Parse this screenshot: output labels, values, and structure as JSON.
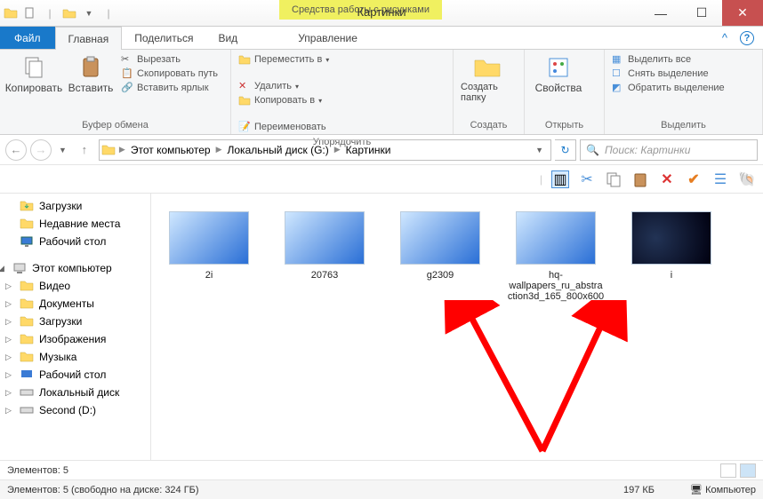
{
  "titlebar": {
    "context_label": "Средства работы с рисунками",
    "title": "Картинки"
  },
  "tabs": {
    "file": "Файл",
    "home": "Главная",
    "share": "Поделиться",
    "view": "Вид",
    "manage": "Управление"
  },
  "ribbon": {
    "clipboard": {
      "copy": "Копировать",
      "paste": "Вставить",
      "cut": "Вырезать",
      "copy_path": "Скопировать путь",
      "paste_shortcut": "Вставить ярлык",
      "label": "Буфер обмена"
    },
    "organize": {
      "move_to": "Переместить в",
      "copy_to": "Копировать в",
      "delete": "Удалить",
      "rename": "Переименовать",
      "label": "Упорядочить"
    },
    "new": {
      "new_folder": "Создать папку",
      "label": "Создать"
    },
    "open": {
      "properties": "Свойства",
      "label": "Открыть"
    },
    "select": {
      "select_all": "Выделить все",
      "select_none": "Снять выделение",
      "invert": "Обратить выделение",
      "label": "Выделить"
    }
  },
  "breadcrumb": {
    "this_pc": "Этот компьютер",
    "drive": "Локальный диск (G:)",
    "folder": "Картинки"
  },
  "search": {
    "placeholder": "Поиск: Картинки"
  },
  "nav": {
    "downloads": "Загрузки",
    "recent": "Недавние места",
    "desktop": "Рабочий стол",
    "this_pc": "Этот компьютер",
    "videos": "Видео",
    "documents": "Документы",
    "downloads2": "Загрузки",
    "pictures": "Изображения",
    "music": "Музыка",
    "desktop2": "Рабочий стол",
    "local_disk": "Локальный диск",
    "second": "Second (D:)"
  },
  "files": [
    {
      "name": "2i"
    },
    {
      "name": "20763"
    },
    {
      "name": "g2309"
    },
    {
      "name": "hq-wallpapers_ru_abstraction3d_165_800x600"
    },
    {
      "name": "i"
    }
  ],
  "info": {
    "elements": "Элементов: 5"
  },
  "status": {
    "left": "Элементов: 5 (свободно на диске: 324 ГБ)",
    "size": "197 КБ",
    "computer": "Компьютер"
  }
}
